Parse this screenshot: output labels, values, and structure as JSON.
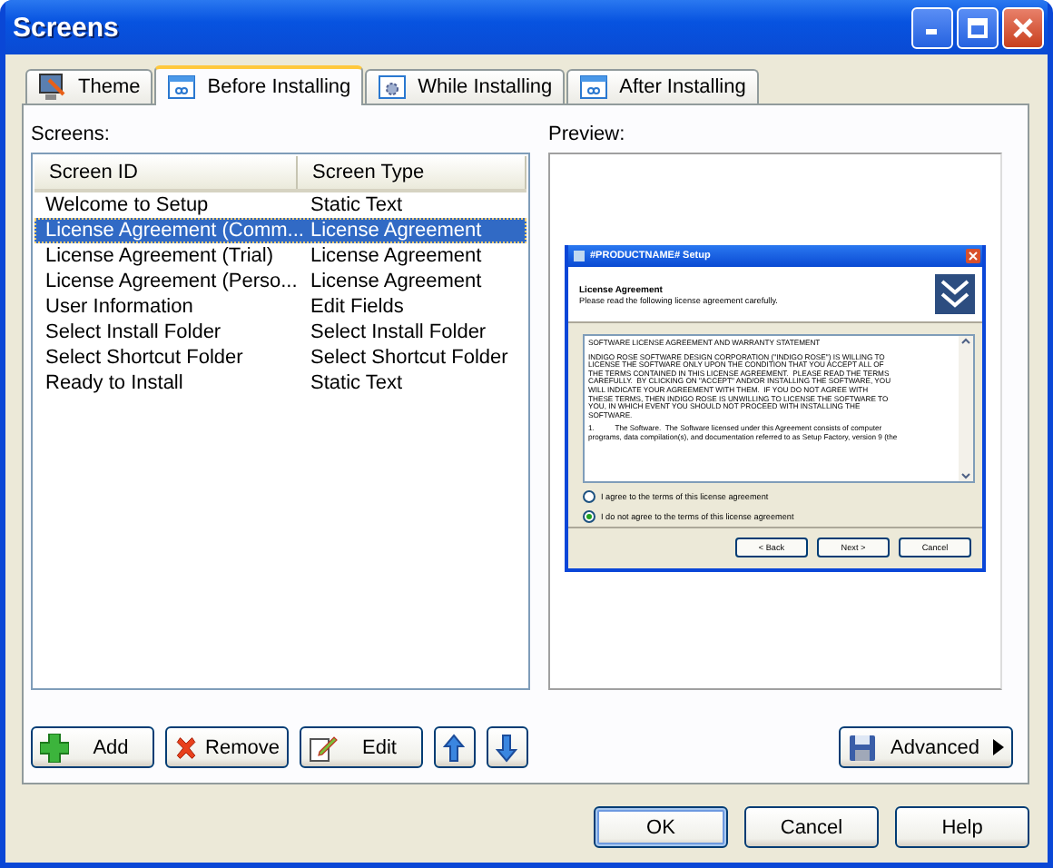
{
  "window": {
    "title": "Screens"
  },
  "tabs": [
    {
      "label": "Theme",
      "selected": false,
      "kind": "theme"
    },
    {
      "label": "Before Installing",
      "selected": true,
      "kind": "window"
    },
    {
      "label": "While Installing",
      "selected": false,
      "kind": "gear"
    },
    {
      "label": "After Installing",
      "selected": false,
      "kind": "window"
    }
  ],
  "screens_label": "Screens:",
  "columns": [
    "Screen ID",
    "Screen Type"
  ],
  "rows": [
    {
      "screen_id": "Welcome to Setup",
      "screen_type": "Static Text",
      "selected": false
    },
    {
      "screen_id": "License Agreement (Comm...",
      "screen_type": "License Agreement",
      "selected": true
    },
    {
      "screen_id": "License Agreement (Trial)",
      "screen_type": "License Agreement",
      "selected": false
    },
    {
      "screen_id": "License Agreement (Perso...",
      "screen_type": "License Agreement",
      "selected": false
    },
    {
      "screen_id": "User Information",
      "screen_type": "Edit Fields",
      "selected": false
    },
    {
      "screen_id": "Select Install Folder",
      "screen_type": "Select Install Folder",
      "selected": false
    },
    {
      "screen_id": "Select Shortcut Folder",
      "screen_type": "Select Shortcut Folder",
      "selected": false
    },
    {
      "screen_id": "Ready to Install",
      "screen_type": "Static Text",
      "selected": false
    }
  ],
  "preview_label": "Preview:",
  "preview": {
    "title": "#PRODUCTNAME# Setup",
    "heading": "License Agreement",
    "subheading": "Please read the following license agreement carefully.",
    "paragraphs": [
      "SOFTWARE LICENSE AGREEMENT AND WARRANTY STATEMENT",
      "INDIGO ROSE SOFTWARE DESIGN CORPORATION (\"INDIGO ROSE\") IS WILLING TO\nLICENSE THE SOFTWARE ONLY UPON THE CONDITION THAT YOU ACCEPT ALL OF\nTHE TERMS CONTAINED IN THIS LICENSE AGREEMENT.  PLEASE READ THE TERMS\nCAREFULLY.  BY CLICKING ON \"ACCEPT\" AND/OR INSTALLING THE SOFTWARE, YOU\nWILL INDICATE YOUR AGREEMENT WITH THEM.  IF YOU DO NOT AGREE WITH\nTHESE TERMS, THEN INDIGO ROSE IS UNWILLING TO LICENSE THE SOFTWARE TO\nYOU, IN WHICH EVENT YOU SHOULD NOT PROCEED WITH INSTALLING THE\nSOFTWARE.",
      "1.          The Software.  The Software licensed under this Agreement consists of computer\nprograms, data compilation(s), and documentation referred to as Setup Factory, version 9 (the"
    ],
    "radios": [
      {
        "label": "I agree to the terms of this license agreement",
        "selected": false
      },
      {
        "label": "I do not agree to the terms of this license agreement",
        "selected": true
      }
    ],
    "buttons": [
      "< Back",
      "Next >",
      "Cancel"
    ]
  },
  "list_buttons": [
    {
      "label": "Add",
      "kind": "add"
    },
    {
      "label": "Remove",
      "kind": "remove"
    },
    {
      "label": "Edit",
      "kind": "edit"
    },
    {
      "kind": "up"
    },
    {
      "kind": "down"
    }
  ],
  "advanced_button": {
    "label": "Advanced"
  },
  "dialog_buttons": [
    {
      "label": "OK",
      "default": true
    },
    {
      "label": "Cancel",
      "default": false
    },
    {
      "label": "Help",
      "default": false
    }
  ]
}
